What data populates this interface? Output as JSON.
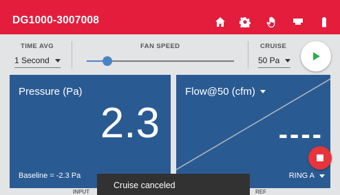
{
  "appbar": {
    "title": "DG1000-3007008",
    "icons": [
      "home-icon",
      "gear-icon",
      "hand-icon",
      "router-icon",
      "battery-icon"
    ]
  },
  "controls": {
    "time_avg": {
      "label": "TIME AVG",
      "value": "1 Second"
    },
    "fan_speed": {
      "label": "FAN SPEED",
      "level": 0.14
    },
    "cruise": {
      "label": "CRUISE",
      "value": "50 Pa"
    }
  },
  "pressure": {
    "title": "Pressure (Pa)",
    "value": "2.3",
    "baseline": "Baseline = -2.3 Pa"
  },
  "flow": {
    "title": "Flow@50 (cfm)",
    "value": "----",
    "ring": "RING A"
  },
  "bottom_labels": {
    "input": "INPUT",
    "ref": "REF"
  },
  "toast": {
    "message": "Cruise canceled"
  },
  "colors": {
    "appbar": "#e41d3d",
    "panel": "#2a5a92",
    "accent": "#4a83c4",
    "play": "#2eab4f",
    "stop": "#e8343b"
  }
}
